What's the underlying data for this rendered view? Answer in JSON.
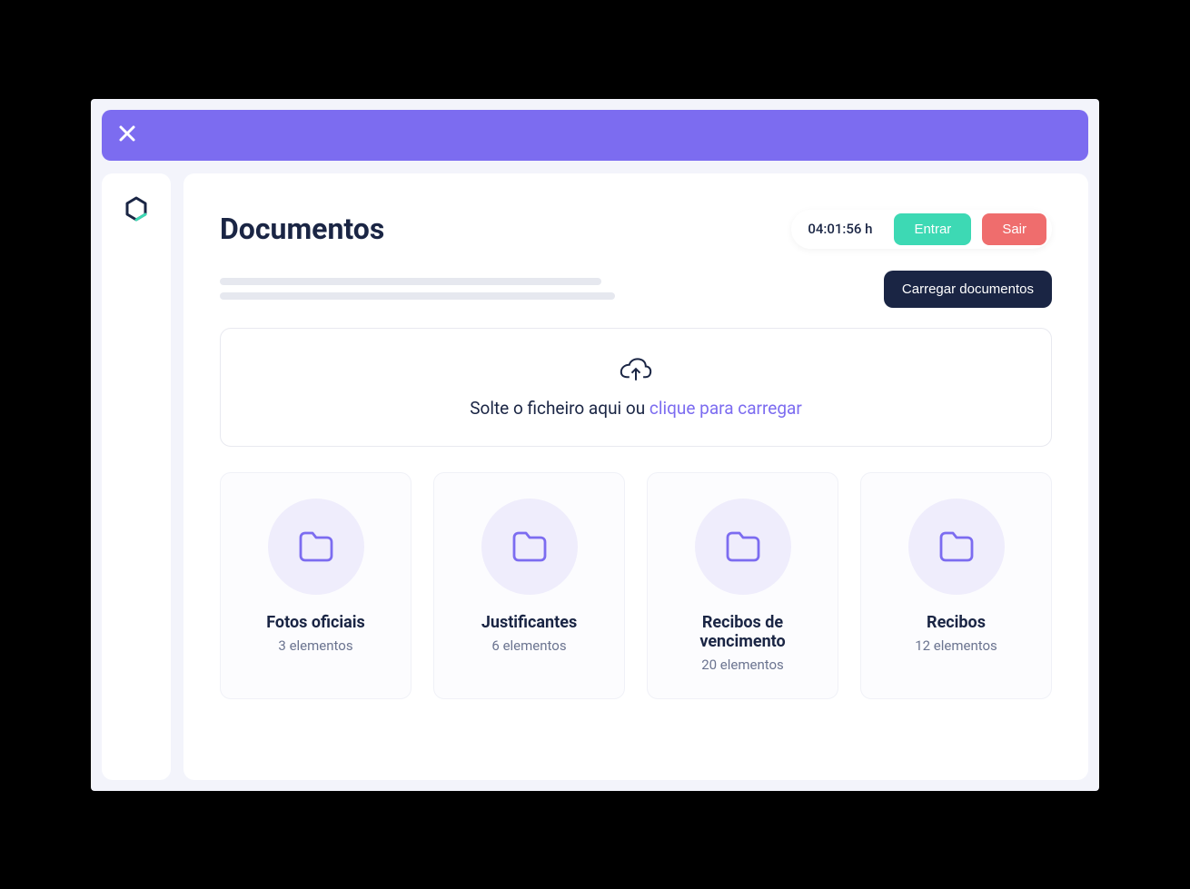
{
  "header": {
    "title": "Documentos",
    "timer": "04:01:56 h",
    "enter_label": "Entrar",
    "exit_label": "Sair",
    "upload_button": "Carregar documentos"
  },
  "dropzone": {
    "text": "Solte o ficheiro aqui ou ",
    "link": "clique para carregar"
  },
  "folders": [
    {
      "title": "Fotos oficiais",
      "count": "3 elementos"
    },
    {
      "title": "Justificantes",
      "count": "6 elementos"
    },
    {
      "title": "Recibos de vencimento",
      "count": "20 elementos"
    },
    {
      "title": "Recibos",
      "count": "12 elementos"
    }
  ]
}
